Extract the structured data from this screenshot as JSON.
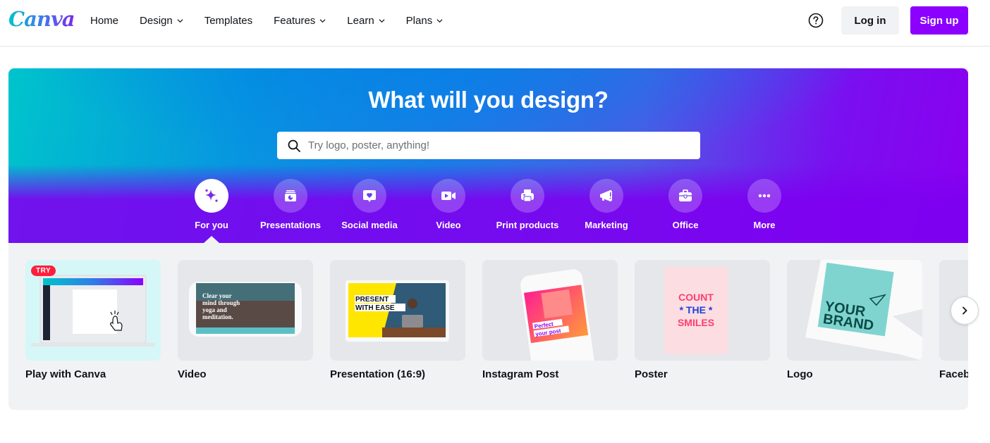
{
  "header": {
    "logo": "Canva",
    "nav": [
      {
        "label": "Home",
        "has_dropdown": false
      },
      {
        "label": "Design",
        "has_dropdown": true
      },
      {
        "label": "Templates",
        "has_dropdown": false
      },
      {
        "label": "Features",
        "has_dropdown": true
      },
      {
        "label": "Learn",
        "has_dropdown": true
      },
      {
        "label": "Plans",
        "has_dropdown": true
      }
    ],
    "help_icon": "question-circle-icon",
    "login_label": "Log in",
    "signup_label": "Sign up"
  },
  "hero": {
    "title": "What will you design?",
    "search_placeholder": "Try logo, poster, anything!",
    "search_value": "",
    "categories": [
      {
        "label": "For you",
        "icon": "sparkle-icon",
        "active": true
      },
      {
        "label": "Presentations",
        "icon": "presentation-icon",
        "active": false
      },
      {
        "label": "Social media",
        "icon": "heart-bubble-icon",
        "active": false
      },
      {
        "label": "Video",
        "icon": "video-camera-icon",
        "active": false
      },
      {
        "label": "Print products",
        "icon": "printer-icon",
        "active": false
      },
      {
        "label": "Marketing",
        "icon": "megaphone-icon",
        "active": false
      },
      {
        "label": "Office",
        "icon": "briefcase-icon",
        "active": false
      },
      {
        "label": "More",
        "icon": "more-dots-icon",
        "active": false
      }
    ]
  },
  "shelf": {
    "items": [
      {
        "label": "Play with Canva",
        "badge": "TRY"
      },
      {
        "label": "Video",
        "thumb_text": "Clear your mind through yoga and meditation."
      },
      {
        "label": "Presentation (16:9)",
        "thumb_text": "PRESENT WITH EASE"
      },
      {
        "label": "Instagram Post",
        "thumb_text": "Perfect your post"
      },
      {
        "label": "Poster",
        "thumb_text": "COUNT THE SMILES"
      },
      {
        "label": "Logo",
        "thumb_text": "YOUR BRAND"
      },
      {
        "label": "Faceb"
      }
    ],
    "next_icon": "chevron-right-icon"
  },
  "colors": {
    "brand_purple": "#8b00ff",
    "brand_teal": "#00c4cc",
    "shelf_bg": "#f1f2f4"
  }
}
